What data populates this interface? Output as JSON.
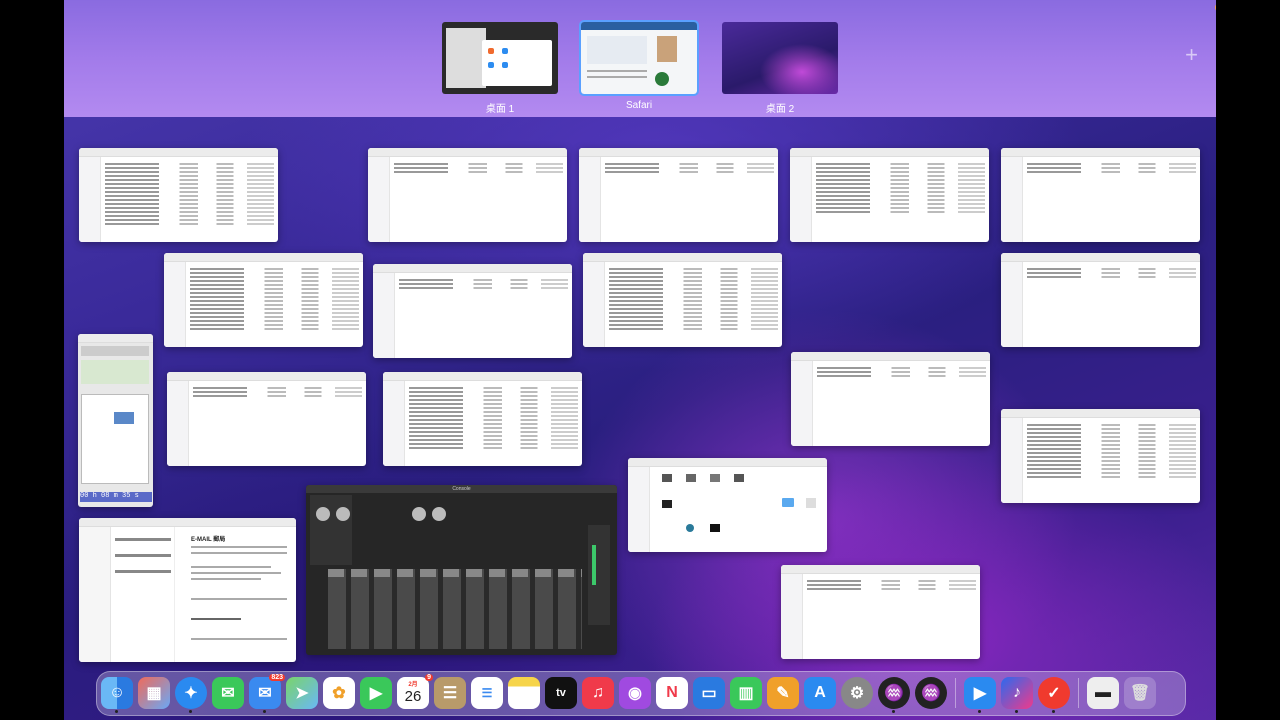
{
  "spaces": [
    {
      "label": "桌面 1"
    },
    {
      "label": "Safari"
    },
    {
      "label": "桌面 2"
    }
  ],
  "add_space_symbol": "+",
  "dock": {
    "mail_badge": "823",
    "calendar_month": "2月",
    "calendar_day": "26",
    "calendar_badge": "9",
    "tv_label": "tv"
  },
  "mixer_title": "Console",
  "recorder_time": "00 h 08 m 35 s",
  "note_title": "E-MAIL 郵局"
}
